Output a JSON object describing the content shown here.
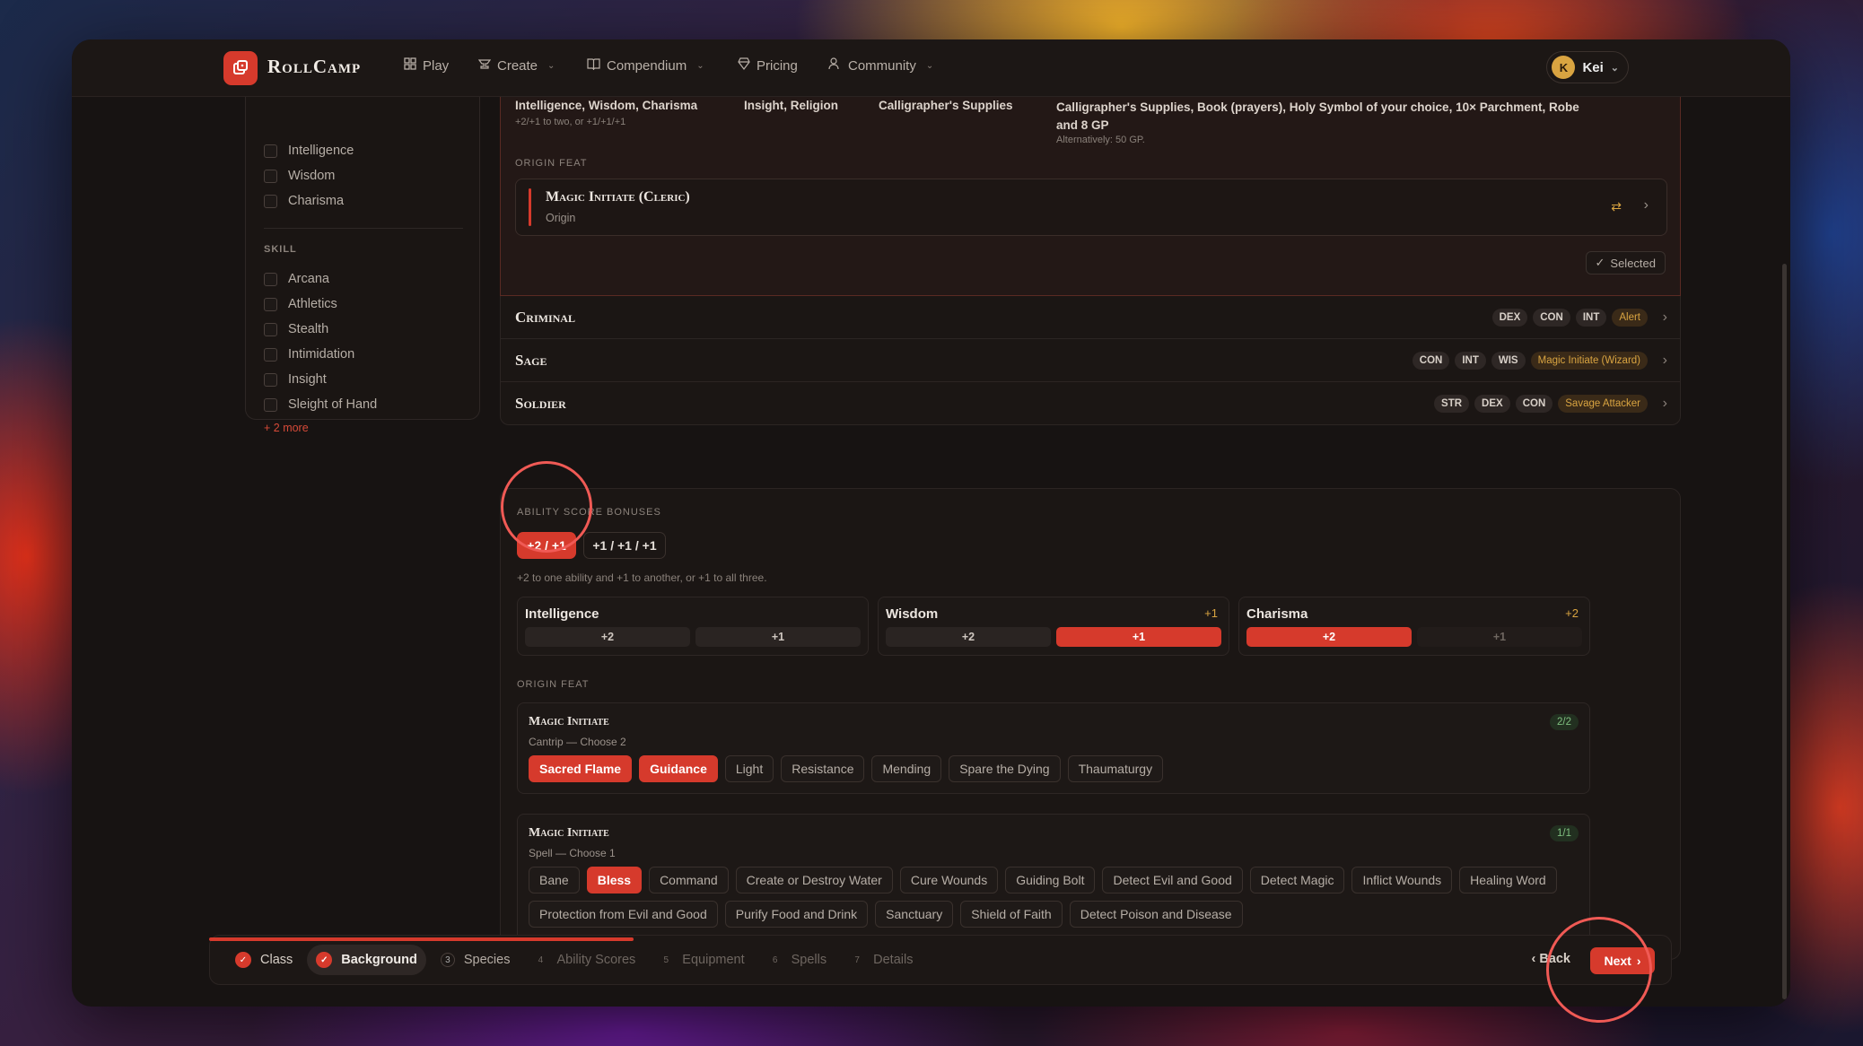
{
  "app": {
    "name": "RollCamp"
  },
  "nav": [
    {
      "label": "Play",
      "icon": "grid-icon",
      "dropdown": false
    },
    {
      "label": "Create",
      "icon": "anvil-icon",
      "dropdown": true
    },
    {
      "label": "Compendium",
      "icon": "book-icon",
      "dropdown": true
    },
    {
      "label": "Pricing",
      "icon": "gem-icon",
      "dropdown": false
    },
    {
      "label": "Community",
      "icon": "users-icon",
      "dropdown": true
    }
  ],
  "user": {
    "initial": "K",
    "name": "Kei"
  },
  "sidebar": {
    "abilities": [
      "Intelligence",
      "Wisdom",
      "Charisma"
    ],
    "skill_label": "SKILL",
    "skills": [
      "Arcana",
      "Athletics",
      "Stealth",
      "Intimidation",
      "Insight",
      "Sleight of Hand"
    ],
    "more": "+ 2 more"
  },
  "selected_background": {
    "abilities": "Intelligence, Wisdom, Charisma",
    "abilities_sub": "+2/+1 to two, or +1/+1/+1",
    "skills": "Insight, Religion",
    "tool": "Calligrapher's Supplies",
    "equipment": "Calligrapher's Supplies, Book (prayers), Holy Symbol of your choice, 10× Parchment, Robe and 8 GP",
    "equipment_alt": "Alternatively: 50 GP.",
    "origin_feat_label": "ORIGIN FEAT",
    "feat_name": "Magic Initiate (Cleric)",
    "feat_type": "Origin",
    "selected_label": "Selected"
  },
  "backgrounds": [
    {
      "name": "Criminal",
      "tags": [
        "DEX",
        "CON",
        "INT"
      ],
      "feat": "Alert"
    },
    {
      "name": "Sage",
      "tags": [
        "CON",
        "INT",
        "WIS"
      ],
      "feat": "Magic Initiate (Wizard)"
    },
    {
      "name": "Soldier",
      "tags": [
        "STR",
        "DEX",
        "CON"
      ],
      "feat": "Savage Attacker"
    }
  ],
  "ability_bonuses": {
    "label": "ABILITY SCORE BONUSES",
    "mode_options": [
      "+2 / +1",
      "+1 / +1 / +1"
    ],
    "mode_selected": "+2 / +1",
    "hint": "+2 to one ability and +1 to another, or +1 to all three.",
    "abilities": [
      {
        "name": "Intelligence",
        "bonus": "",
        "options": [
          "+2",
          "+1"
        ],
        "selected": ""
      },
      {
        "name": "Wisdom",
        "bonus": "+1",
        "options": [
          "+2",
          "+1"
        ],
        "selected": "+1"
      },
      {
        "name": "Charisma",
        "bonus": "+2",
        "options": [
          "+2",
          "+1"
        ],
        "selected": "+2"
      }
    ]
  },
  "origin_feat": {
    "label": "ORIGIN FEAT",
    "cantrips": {
      "title": "Magic Initiate",
      "subtitle": "Cantrip — Choose 2",
      "count": "2/2",
      "options": [
        "Sacred Flame",
        "Guidance",
        "Light",
        "Resistance",
        "Mending",
        "Spare the Dying",
        "Thaumaturgy"
      ],
      "selected": [
        "Sacred Flame",
        "Guidance"
      ]
    },
    "spells": {
      "title": "Magic Initiate",
      "subtitle": "Spell — Choose 1",
      "count": "1/1",
      "options": [
        "Bane",
        "Bless",
        "Command",
        "Create or Destroy Water",
        "Cure Wounds",
        "Guiding Bolt",
        "Detect Evil and Good",
        "Detect Magic",
        "Inflict Wounds",
        "Healing Word",
        "Protection from Evil and Good",
        "Purify Food and Drink",
        "Sanctuary",
        "Shield of Faith",
        "Detect Poison and Disease"
      ],
      "selected": [
        "Bless"
      ]
    }
  },
  "wizard": {
    "progress": 0.29,
    "steps": [
      {
        "num": "",
        "label": "Class",
        "state": "done"
      },
      {
        "num": "",
        "label": "Background",
        "state": "current"
      },
      {
        "num": "3",
        "label": "Species",
        "state": "pending"
      },
      {
        "num": "4",
        "label": "Ability Scores",
        "state": "todo"
      },
      {
        "num": "5",
        "label": "Equipment",
        "state": "todo"
      },
      {
        "num": "6",
        "label": "Spells",
        "state": "todo"
      },
      {
        "num": "7",
        "label": "Details",
        "state": "todo"
      }
    ],
    "back_label": "Back",
    "next_label": "Next"
  },
  "colors": {
    "accent": "#d63a2c",
    "gold": "#d9a441",
    "highlight_ring": "#f05a55"
  }
}
